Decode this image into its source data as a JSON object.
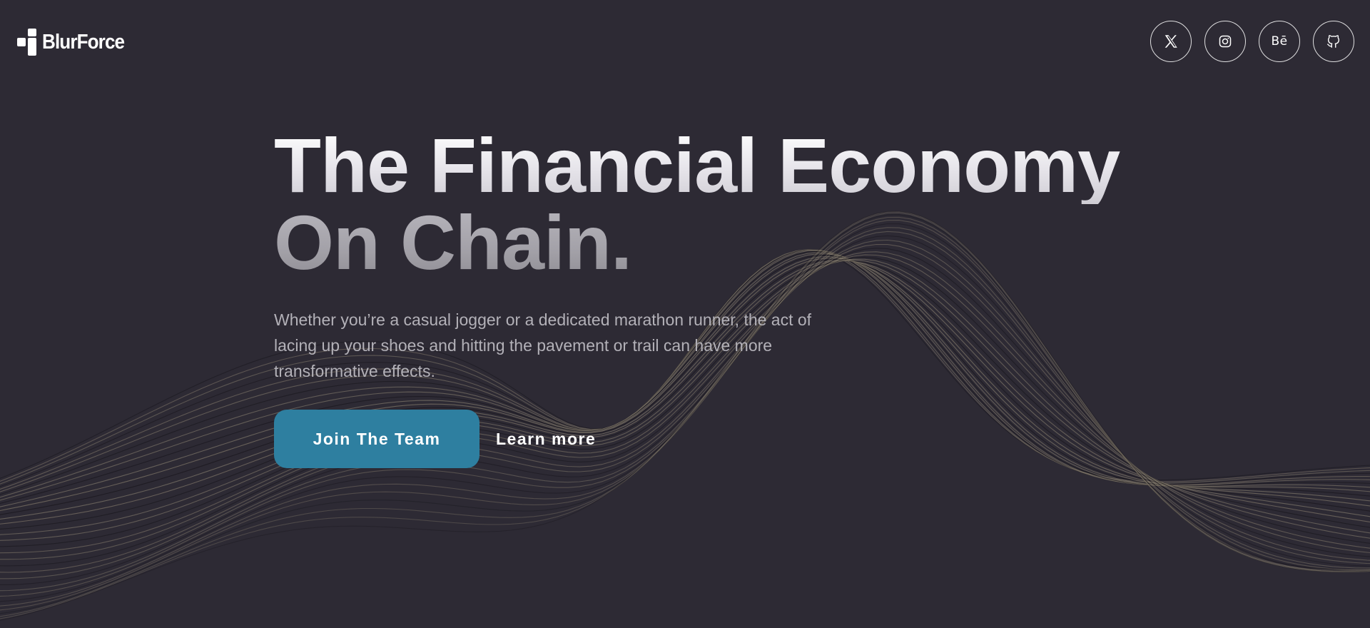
{
  "brand": {
    "name": "BlurForce"
  },
  "social": [
    {
      "name": "X",
      "icon": "x-icon"
    },
    {
      "name": "Instagram",
      "icon": "instagram-icon"
    },
    {
      "name": "Behance",
      "icon": "behance-icon",
      "glyph": "Bē"
    },
    {
      "name": "GitHub",
      "icon": "github-icon"
    }
  ],
  "hero": {
    "title_line1": "The Financial Economy",
    "title_line2": "On Chain.",
    "subtitle": "Whether you’re a casual jogger or a dedicated marathon runner, the act of lacing up your shoes and hitting the pavement or trail can have more transformative effects.",
    "primary_cta": "Join The Team",
    "secondary_cta": "Learn more"
  },
  "colors": {
    "background": "#2d2a34",
    "accent": "#2e7fa0",
    "wave_light": "#8a8170",
    "wave_dark": "#16141a"
  }
}
